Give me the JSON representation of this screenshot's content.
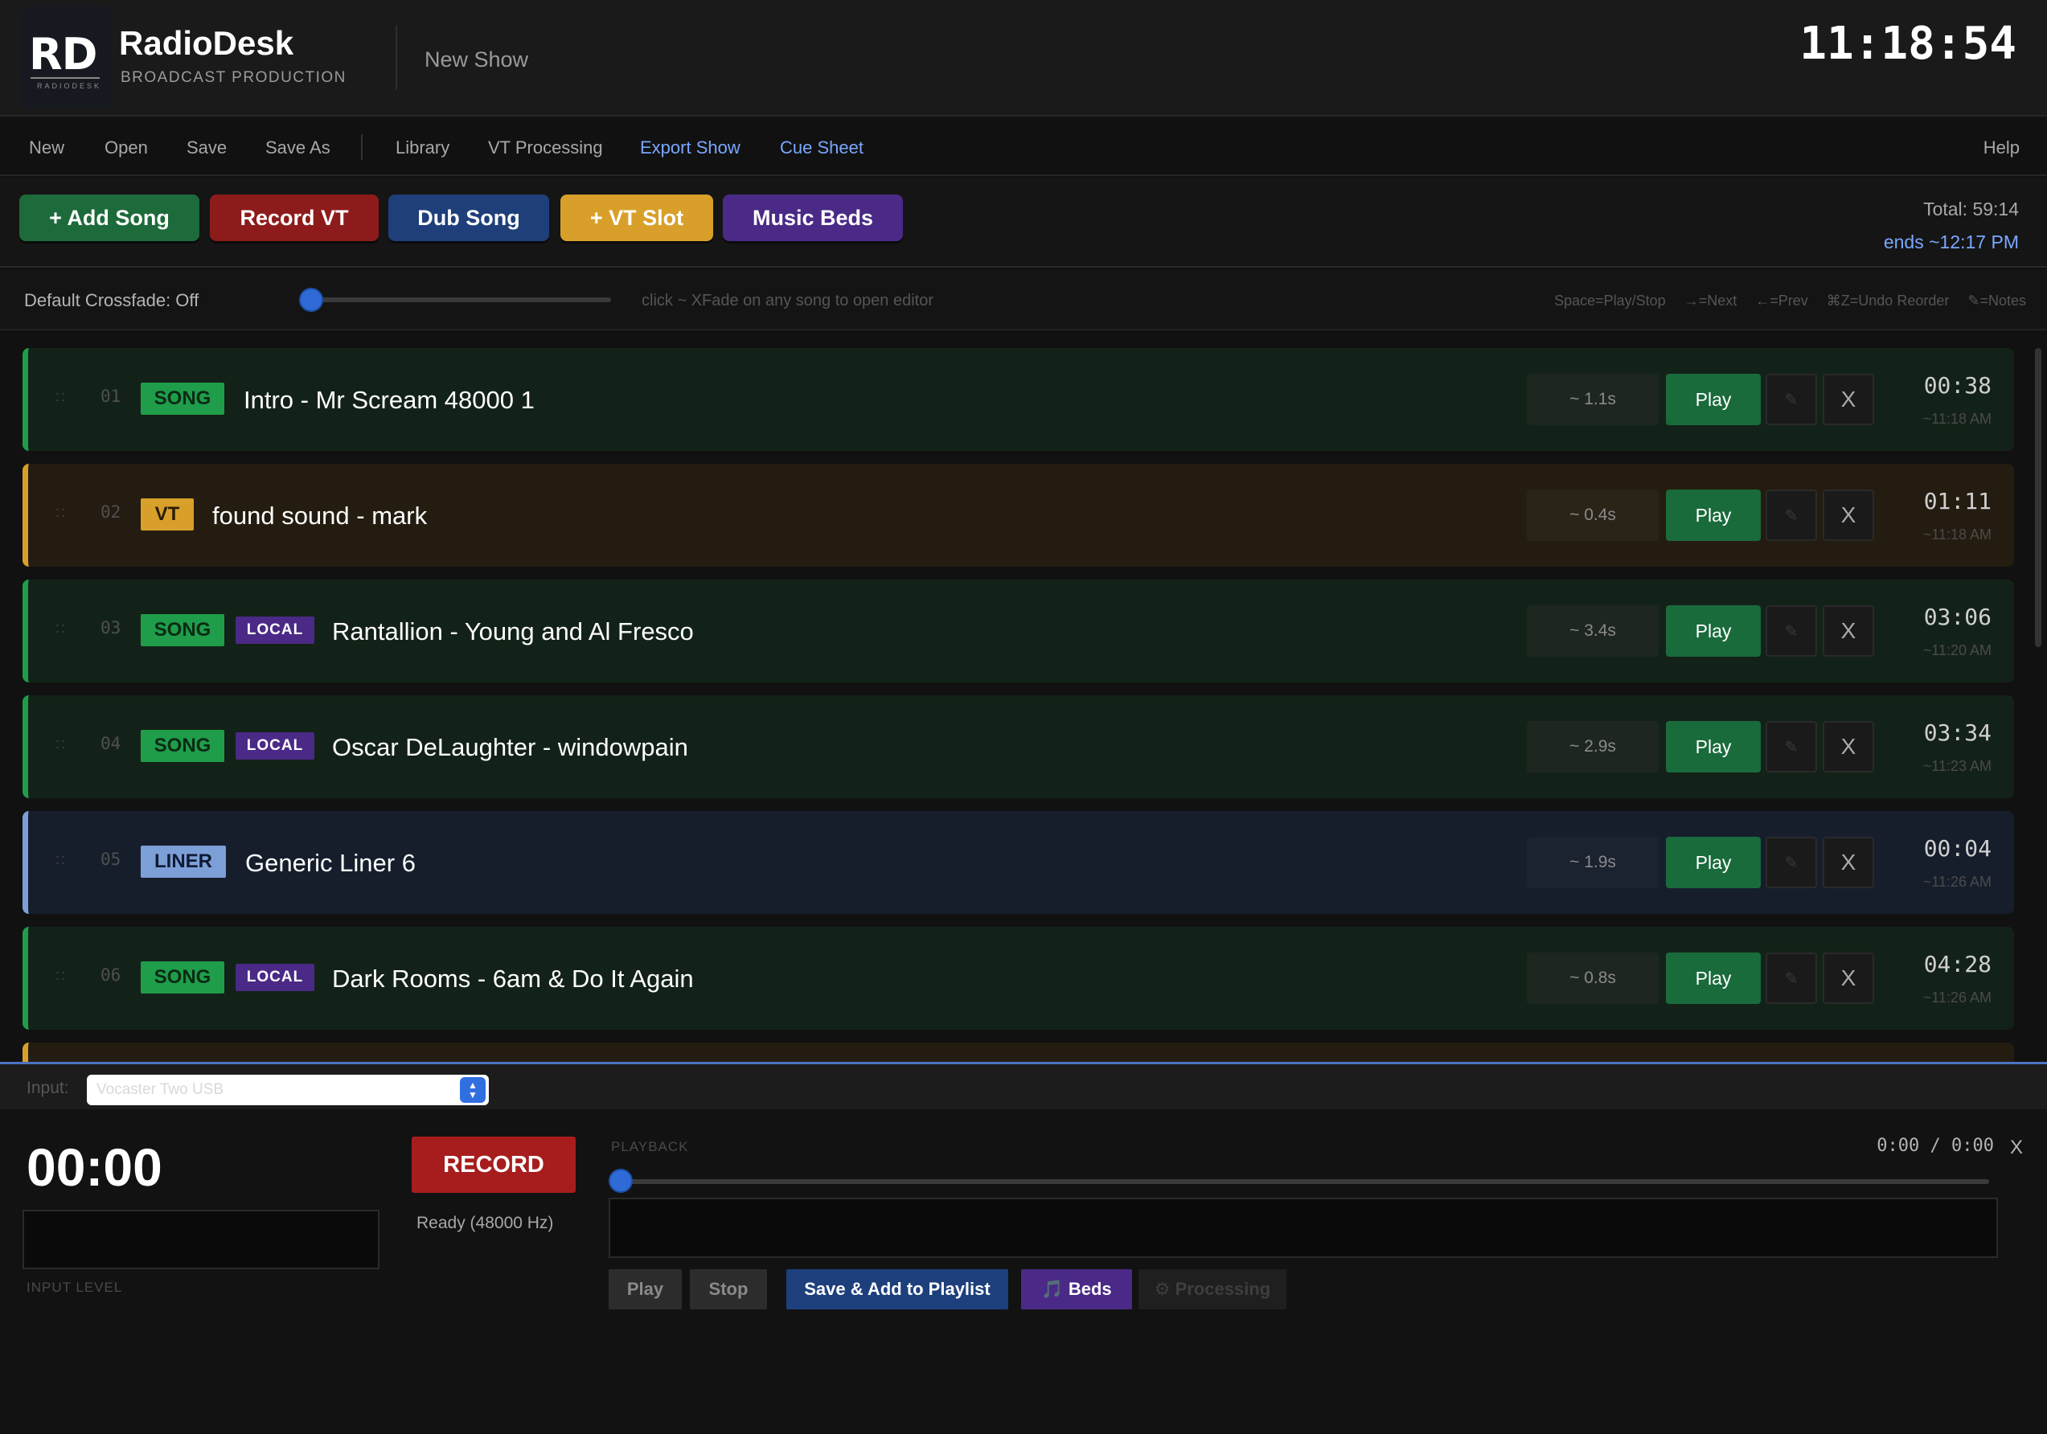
{
  "header": {
    "logo_text": "RD",
    "logo_small": "RADIODESK",
    "app_name": "RadioDesk",
    "app_subtitle": "BROADCAST PRODUCTION",
    "show_title": "New Show",
    "clock": "11:18:54"
  },
  "menu": {
    "new": "New",
    "open": "Open",
    "save": "Save",
    "save_as": "Save As",
    "library": "Library",
    "vt_processing": "VT Processing",
    "export_show": "Export Show",
    "cue_sheet": "Cue Sheet",
    "help": "Help"
  },
  "toolbar": {
    "add_song": "+ Add Song",
    "record_vt": "Record VT",
    "dub_song": "Dub Song",
    "vt_slot": "+ VT Slot",
    "music_beds": "Music Beds",
    "total": "Total: 59:14",
    "ends": "ends ~12:17 PM"
  },
  "crossfade": {
    "label": "Default Crossfade: Off",
    "value": 0,
    "hint": "click ~ XFade on any song to open editor",
    "shortcuts": [
      "Space=Play/Stop",
      "→=Next",
      "←=Prev",
      "⌘Z=Undo Reorder",
      "✎=Notes"
    ]
  },
  "playlist": {
    "grip": "::",
    "play_label": "Play",
    "edit_icon": "✎",
    "delete_label": "X",
    "rows": [
      {
        "num": "01",
        "type": "SONG",
        "local": "",
        "title": "Intro - Mr Scream 48000 1",
        "xfade": "~ 1.1s",
        "duration": "00:38",
        "time": "~11:18 AM"
      },
      {
        "num": "02",
        "type": "VT",
        "local": "",
        "title": "found sound - mark",
        "xfade": "~ 0.4s",
        "duration": "01:11",
        "time": "~11:18 AM"
      },
      {
        "num": "03",
        "type": "SONG",
        "local": "LOCAL",
        "title": "Rantallion - Young and Al Fresco",
        "xfade": "~ 3.4s",
        "duration": "03:06",
        "time": "~11:20 AM"
      },
      {
        "num": "04",
        "type": "SONG",
        "local": "LOCAL",
        "title": "Oscar DeLaughter - windowpain",
        "xfade": "~ 2.9s",
        "duration": "03:34",
        "time": "~11:23 AM"
      },
      {
        "num": "05",
        "type": "LINER",
        "local": "",
        "title": "Generic Liner 6",
        "xfade": "~ 1.9s",
        "duration": "00:04",
        "time": "~11:26 AM"
      },
      {
        "num": "06",
        "type": "SONG",
        "local": "LOCAL",
        "title": "Dark Rooms - 6am & Do It Again",
        "xfade": "~ 0.8s",
        "duration": "04:28",
        "time": "~11:26 AM"
      }
    ]
  },
  "recorder": {
    "input_label": "Input:",
    "input_device": "Vocaster Two USB",
    "timer": "00:00",
    "record_label": "RECORD",
    "status": "Ready  (48000 Hz)",
    "input_level_label": "INPUT LEVEL",
    "playback_label": "PLAYBACK",
    "playback_time": "0:00 / 0:00",
    "close_label": "X",
    "play": "Play",
    "stop": "Stop",
    "save_add": "Save & Add to Playlist",
    "beds": "🎵 Beds",
    "processing": "⚙ Processing"
  },
  "colors": {
    "song": "#1f9d4a",
    "vt": "#d8a02a",
    "liner": "#7d9fd8",
    "local": "#4a2a86",
    "accent": "#7aa7ff",
    "record": "#a71d1d"
  }
}
